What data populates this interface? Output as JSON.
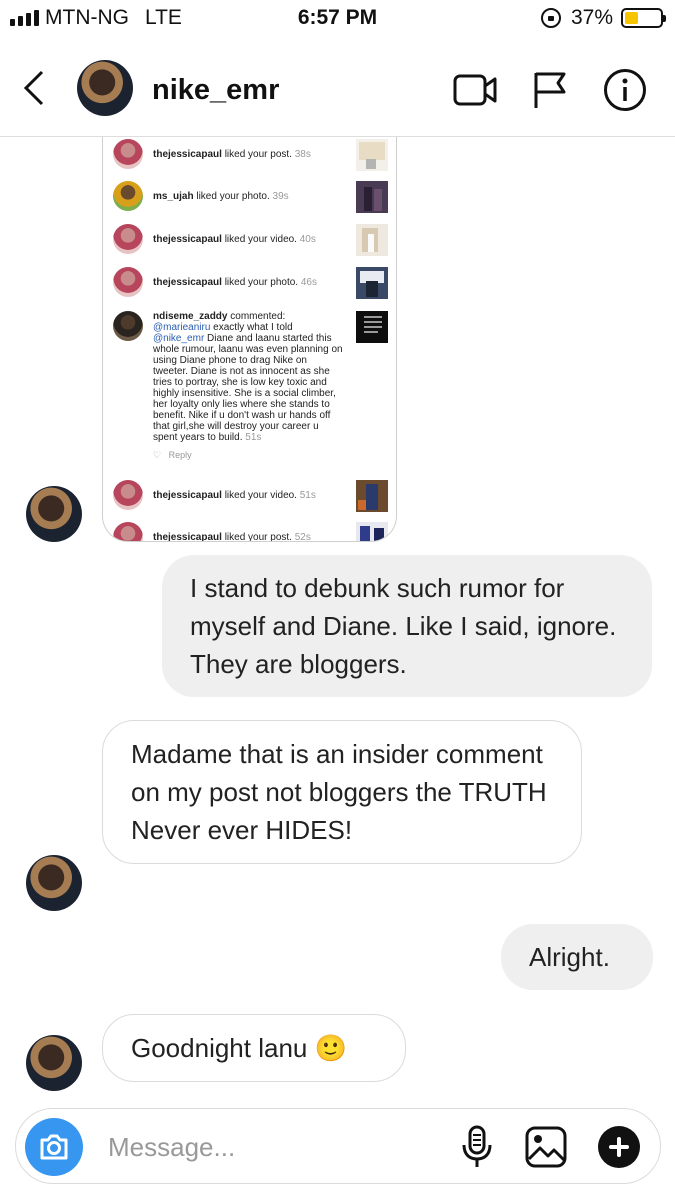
{
  "status_bar": {
    "carrier": "MTN-NG",
    "network": "LTE",
    "time": "6:57 PM",
    "battery": "37%",
    "battery_level": 0.37
  },
  "header": {
    "username": "nike_emr",
    "icons": [
      "back-chevron-icon",
      "video-call-icon",
      "flag-icon",
      "info-icon"
    ]
  },
  "shared_notifications": [
    {
      "user": "thejessicapaul",
      "action": "liked your post.",
      "time": "38s"
    },
    {
      "user": "ms_ujah",
      "action": "liked your photo.",
      "time": "39s"
    },
    {
      "user": "thejessicapaul",
      "action": "liked your video.",
      "time": "40s"
    },
    {
      "user": "thejessicapaul",
      "action": "liked your photo.",
      "time": "46s"
    },
    {
      "user": "ndiseme_zaddy",
      "action": "commented:",
      "mention1": "@marieaniru",
      "text1": " exactly what I told ",
      "mention2": "@nike_emr",
      "text2": " Diane and laanu started this whole rumour, laanu was even planning on using Diane phone to drag Nike on tweeter. Diane is not as innocent as she tries to portray, she is low key toxic and highly insensitive. She is a social climber, her loyalty only lies where she stands to benefit. Nike if u don't wash ur hands off that girl,she will destroy your career u spent years to build.",
      "time": "51s",
      "reply": "Reply"
    },
    {
      "user": "thejessicapaul",
      "action": "liked your video.",
      "time": "51s"
    },
    {
      "user": "thejessicapaul",
      "action": "liked your post.",
      "time": "52s"
    }
  ],
  "messages": [
    {
      "from": "me",
      "text": "I stand to debunk such rumor for myself and Diane. Like I said, ignore. They are bloggers."
    },
    {
      "from": "them",
      "text": "Madame that is an insider comment on my post not bloggers the TRUTH Never ever HIDES!"
    },
    {
      "from": "me",
      "text": "Alright."
    },
    {
      "from": "them",
      "text": "Goodnight lanu 🙂"
    }
  ],
  "composer": {
    "placeholder": "Message...",
    "icons": [
      "camera-icon",
      "microphone-icon",
      "gallery-icon",
      "add-icon"
    ]
  },
  "colors": {
    "accent": "#3797f0",
    "outgoing_bubble": "#efefef",
    "battery": "#f6c400"
  }
}
